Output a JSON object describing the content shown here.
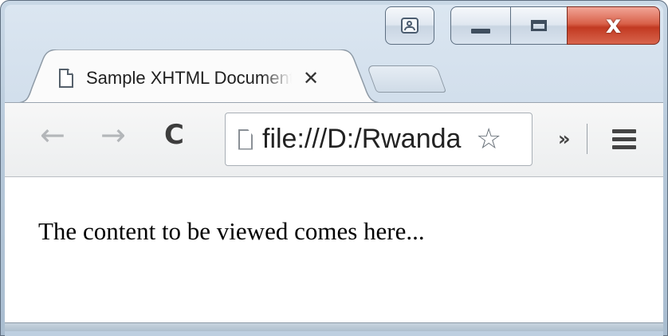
{
  "window": {
    "caption_buttons": {
      "user_icon": "user-profile-icon",
      "minimize_icon": "minimize-icon",
      "maximize_icon": "maximize-icon",
      "close_label": "x"
    }
  },
  "tab": {
    "title": "Sample XHTML Document",
    "icon": "page-icon",
    "close_label": "✕"
  },
  "toolbar": {
    "back_label": "←",
    "forward_label": "→",
    "reload_label": "C",
    "url": "file:///D:/Rwanda",
    "bookmark_label": "☆",
    "extensions_label": "»"
  },
  "page": {
    "content": "The content to be viewed comes here..."
  },
  "colors": {
    "frame": "#bccfe0",
    "close_button": "#c9442c",
    "toolbar": "#f2f2f2"
  }
}
